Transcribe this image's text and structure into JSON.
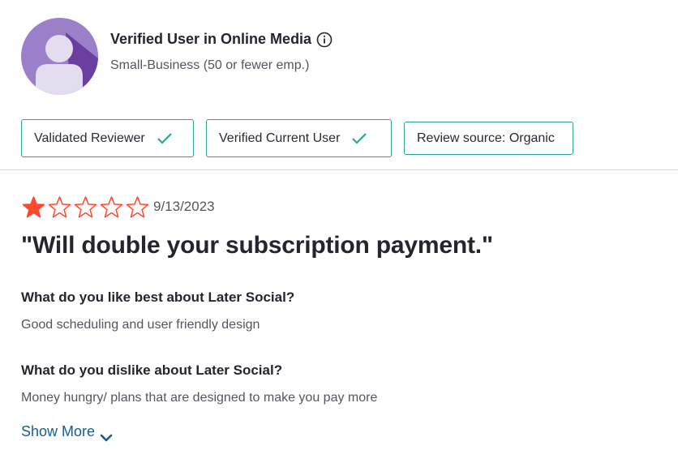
{
  "reviewer": {
    "name": "Verified User in Online Media",
    "segment": "Small-Business (50 or fewer emp.)",
    "avatar_colors": {
      "background": "#9b7fc9",
      "shadow": "#6a3fa0",
      "figure": "#e4dcef"
    }
  },
  "badges": [
    {
      "label": "Validated Reviewer",
      "icon": "check-icon"
    },
    {
      "label": "Verified Current User",
      "icon": "check-icon"
    },
    {
      "label": "Review source: Organic"
    }
  ],
  "review": {
    "rating": 1,
    "max_rating": 5,
    "date": "9/13/2023",
    "title": "\"Will double your subscription payment.\"",
    "questions": [
      {
        "question": "What do you like best about Later Social?",
        "answer": "Good scheduling and user friendly design"
      },
      {
        "question": "What do you dislike about Later Social?",
        "answer": "Money hungry/ plans that are designed to make you pay more"
      }
    ],
    "show_more_label": "Show More"
  },
  "colors": {
    "star": "#ff492c",
    "badge_border": "#2ca58d",
    "check": "#2ca58d",
    "link": "#1a5d8f"
  }
}
